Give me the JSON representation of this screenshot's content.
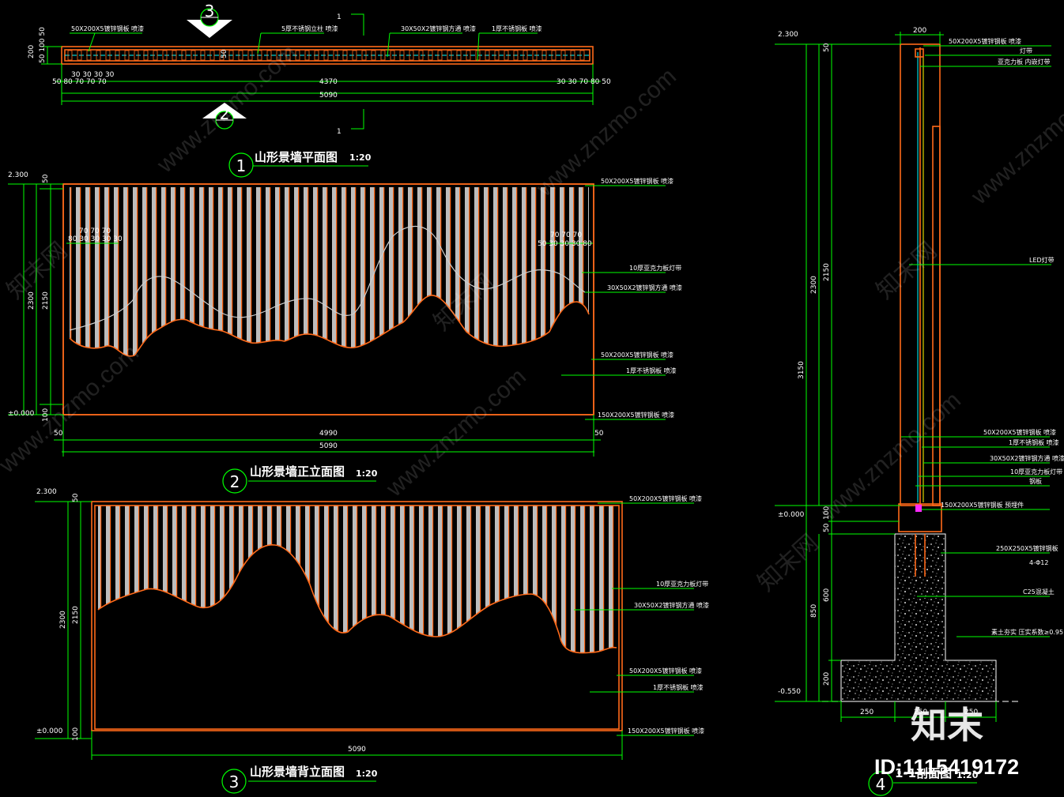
{
  "views": {
    "plan": {
      "title": "山形景墙平面图",
      "scale": "1:20",
      "number": "1"
    },
    "front": {
      "title": "山形景墙正立面图",
      "scale": "1:20",
      "number": "2"
    },
    "back": {
      "title": "山形景墙背立面图",
      "scale": "1:20",
      "number": "3"
    },
    "section": {
      "title": "1-1剖面图",
      "scale": "1:20",
      "number": "4"
    }
  },
  "section_marks": {
    "top": "3",
    "bottom": "2",
    "cut": "1"
  },
  "plan_dims": {
    "small_left": "30 30 30 30",
    "row_left": "50 80 70 70 70",
    "middle": "4370",
    "row_right": "30 30 70 80 50",
    "overall": "5090",
    "depth_a": "200",
    "depth_b": "50 100 50",
    "center": "50"
  },
  "plan_notes": [
    "50X200X5镀锌钢板 喷漆",
    "5厚不锈钢立柱 喷漆",
    "30X50X2镀锌钢方通 喷漆",
    "1厚不锈钢板 喷漆"
  ],
  "front_dims": {
    "elev_top": "2.300",
    "elev_bottom": "±0.000",
    "height_total": "2300",
    "height_inner": "2150",
    "top": "50",
    "bottom": "100",
    "width_inner": "4990",
    "width_total": "5090",
    "side_left": "50",
    "side_right": "50",
    "detail_left": "70 70 70",
    "detail_left2": "80 30 30 30 30",
    "detail_right": "70 70 70",
    "detail_right2": "50 30 30 30 80"
  },
  "front_notes": [
    "50X200X5镀锌钢板 喷漆",
    "10厚亚克力板灯带",
    "30X50X2镀锌钢方通 喷漆",
    "50X200X5镀锌钢板 喷漆",
    "1厚不锈钢板 喷漆",
    "150X200X5镀锌钢板 喷漆"
  ],
  "back_dims": {
    "elev_top": "2.300",
    "elev_bottom": "±0.000",
    "height_total": "2300",
    "height_inner": "2150",
    "top": "50",
    "bottom": "100",
    "width_total": "5090"
  },
  "back_notes": [
    "50X200X5镀锌钢板 喷漆",
    "10厚亚克力板灯带",
    "30X50X2镀锌钢方通 喷漆",
    "50X200X5镀锌钢板 喷漆",
    "1厚不锈钢板 喷漆",
    "150X200X5镀锌钢板 喷漆"
  ],
  "section_dims": {
    "elev_top": "2.300",
    "elev_zero": "±0.000",
    "elev_bottom": "-0.550",
    "width_top": "200",
    "total": "3150",
    "wall": "2300",
    "wall_inner": "2150",
    "top": "50",
    "base": "100",
    "plinth": "50",
    "found": "850",
    "pier": "600",
    "footing": "200",
    "foot_left": "250",
    "foot_mid": "250",
    "foot_right": "250"
  },
  "section_notes": [
    "50X200X5镀锌钢板 喷漆",
    "灯带",
    "亚克力板 内嵌灯带",
    "LED灯带",
    "50X200X5镀锌钢板 喷漆",
    "1厚不锈钢板 喷漆",
    "30X50X2镀锌钢方通 喷漆",
    "10厚亚克力板灯带",
    "钢板",
    "150X200X5镀锌钢板 预埋件",
    "250X250X5镀锌钢板",
    "4-Φ12",
    "C25混凝土",
    "素土夯实 压实系数≥0.95"
  ],
  "watermark": "www.znzmo.com",
  "watermark_cn": "知末网",
  "logo": "知末",
  "image_id": "ID:1115419172"
}
